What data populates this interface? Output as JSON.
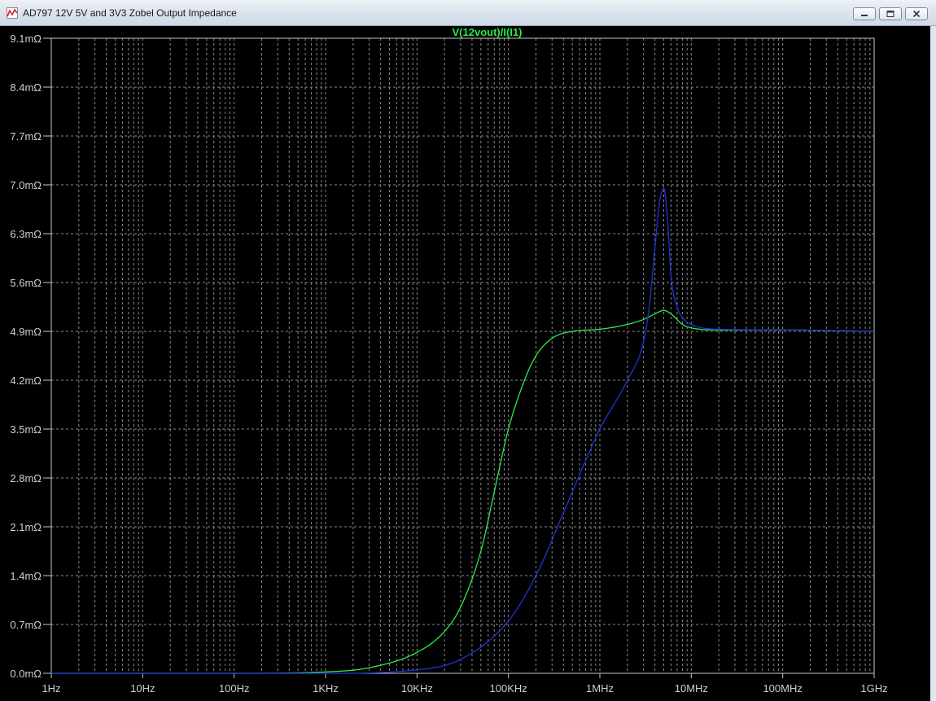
{
  "window": {
    "title": "AD797 12V 5V and 3V3 Zobel Output Impedance"
  },
  "icons": {
    "app": "waveform-icon",
    "minimize": "minimize-icon",
    "maximize": "maximize-icon",
    "close": "close-icon"
  },
  "colors": {
    "background": "#000000",
    "grid": "#8a8a8a",
    "axis_text": "#cfcfcf",
    "green_trace": "#2de84b",
    "blue_trace": "#2033d8"
  },
  "chart_data": {
    "type": "line",
    "title": "V(12vout)/I(I1)",
    "x_scale": "log",
    "y_unit": "mΩ",
    "xlim": [
      1,
      1000000000
    ],
    "ylim": [
      0.0,
      9.1
    ],
    "x_ticks": [
      1,
      10,
      100,
      1000,
      10000,
      100000,
      1000000,
      10000000,
      100000000,
      1000000000
    ],
    "x_tick_labels": [
      "1Hz",
      "10Hz",
      "100Hz",
      "1KHz",
      "10KHz",
      "100KHz",
      "1MHz",
      "10MHz",
      "100MHz",
      "1GHz"
    ],
    "y_ticks": [
      0.0,
      0.7,
      1.4,
      2.1,
      2.8,
      3.5,
      4.2,
      4.9,
      5.6,
      6.3,
      7.0,
      7.7,
      8.4,
      9.1
    ],
    "y_tick_labels": [
      "0.0mΩ",
      "0.7mΩ",
      "1.4mΩ",
      "2.1mΩ",
      "2.8mΩ",
      "3.5mΩ",
      "4.2mΩ",
      "4.9mΩ",
      "5.6mΩ",
      "6.3mΩ",
      "7.0mΩ",
      "7.7mΩ",
      "8.4mΩ",
      "9.1mΩ"
    ],
    "grid": true,
    "series": [
      {
        "color": "#2de84b",
        "x": [
          1,
          100,
          1000,
          3000,
          10000,
          20000,
          30000,
          50000,
          70000,
          100000,
          150000,
          200000,
          300000,
          500000,
          1000000,
          2000000,
          3000000,
          4000000,
          5000000,
          6000000,
          8000000,
          10000000,
          20000000,
          100000000,
          1000000000
        ],
        "y": [
          0.0,
          0.0,
          0.02,
          0.08,
          0.3,
          0.6,
          0.95,
          1.75,
          2.6,
          3.5,
          4.2,
          4.55,
          4.8,
          4.9,
          4.93,
          5.0,
          5.07,
          5.15,
          5.2,
          5.15,
          5.0,
          4.95,
          4.92,
          4.92,
          4.9
        ]
      },
      {
        "color": "#2033d8",
        "x": [
          1,
          1000,
          10000,
          30000,
          100000,
          200000,
          400000,
          700000,
          1000000,
          2000000,
          3000000,
          3500000,
          4000000,
          4500000,
          5000000,
          5500000,
          6000000,
          7000000,
          8000000,
          10000000,
          20000000,
          100000000,
          1000000000
        ],
        "y": [
          0.0,
          0.0,
          0.05,
          0.2,
          0.75,
          1.4,
          2.3,
          3.05,
          3.5,
          4.2,
          4.75,
          5.3,
          6.1,
          6.75,
          6.95,
          6.5,
          5.7,
          5.25,
          5.1,
          5.0,
          4.93,
          4.92,
          4.9
        ]
      }
    ]
  }
}
